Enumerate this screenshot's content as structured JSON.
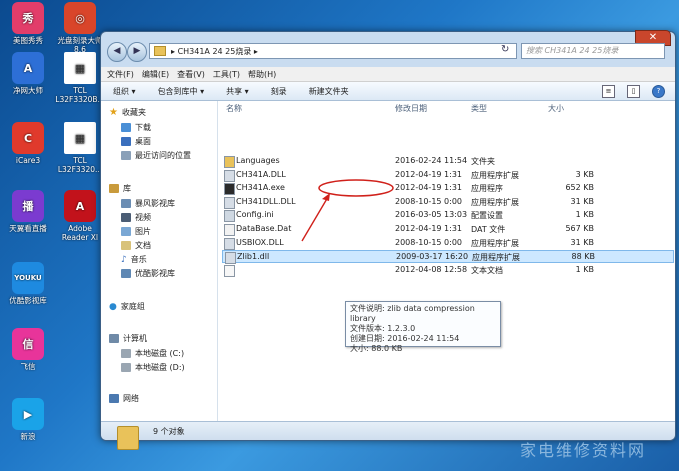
{
  "desktop": {
    "icons": [
      {
        "label": "美图秀秀",
        "color": "#e23d6a",
        "glyph": "秀"
      },
      {
        "label": "光盘刻录大师 8.6",
        "color": "#d9452a",
        "glyph": "◎"
      },
      {
        "label": "净网大师",
        "color": "#2d6fd6",
        "glyph": "A"
      },
      {
        "label": "TCL L32F3320B...",
        "color": "#ffffff",
        "glyph": "▦"
      },
      {
        "label": "iCare3",
        "color": "#e03a2c",
        "glyph": "C"
      },
      {
        "label": "TCL L32F3320...",
        "color": "#ffffff",
        "glyph": "▦"
      },
      {
        "label": "天翼看直播",
        "color": "#7b3bd0",
        "glyph": "播"
      },
      {
        "label": "Adobe Reader XI",
        "color": "#c2121b",
        "glyph": "A"
      },
      {
        "label": "优酷影视库",
        "color": "#1e8ae0",
        "glyph": "YOUKU"
      },
      {
        "label": "飞信",
        "color": "#e8349a",
        "glyph": "信"
      },
      {
        "label": "新浪",
        "color": "#1aa3e8",
        "glyph": "▶"
      }
    ]
  },
  "window": {
    "address": "CH341A 24 25烧录",
    "search_placeholder": "搜索 CH341A 24 25烧录",
    "menu": [
      "文件(F)",
      "编辑(E)",
      "查看(V)",
      "工具(T)",
      "帮助(H)"
    ],
    "toolbar": [
      "组织 ▾",
      "包含到库中 ▾",
      "共享 ▾",
      "刻录",
      "新建文件夹"
    ],
    "nav": {
      "favorites": "收藏夹",
      "favorites_items": [
        "下载",
        "桌面",
        "最近访问的位置"
      ],
      "libraries": "库",
      "library_items": [
        "暴风影视库",
        "视频",
        "图片",
        "文档",
        "音乐",
        "优酷影视库"
      ],
      "homegroup": "家庭组",
      "computer": "计算机",
      "computer_items": [
        "本地磁盘 (C:)",
        "本地磁盘 (D:)"
      ],
      "network": "网络"
    },
    "columns": {
      "name": "名称",
      "date": "修改日期",
      "type": "类型",
      "size": "大小"
    },
    "files": [
      {
        "name": "Languages",
        "date": "2016-02-24 11:54",
        "type": "文件夹",
        "size": "",
        "kind": "folder"
      },
      {
        "name": "CH341A.DLL",
        "date": "2012-04-19 1:31",
        "type": "应用程序扩展",
        "size": "3 KB",
        "kind": "dll"
      },
      {
        "name": "CH341A.exe",
        "date": "2012-04-19 1:31",
        "type": "应用程序",
        "size": "652 KB",
        "kind": "exe"
      },
      {
        "name": "CH341DLL.DLL",
        "date": "2008-10-15 0:00",
        "type": "应用程序扩展",
        "size": "31 KB",
        "kind": "dll"
      },
      {
        "name": "Config.ini",
        "date": "2016-03-05 13:03",
        "type": "配置设置",
        "size": "1 KB",
        "kind": "ini"
      },
      {
        "name": "DataBase.Dat",
        "date": "2012-04-19 1:31",
        "type": "DAT 文件",
        "size": "567 KB",
        "kind": "dat"
      },
      {
        "name": "USBIOX.DLL",
        "date": "2008-10-15 0:00",
        "type": "应用程序扩展",
        "size": "31 KB",
        "kind": "dll"
      },
      {
        "name": "Zlib1.dll",
        "date": "2009-03-17 16:20",
        "type": "应用程序扩展",
        "size": "88 KB",
        "kind": "dll"
      },
      {
        "name": "",
        "date": "2012-04-08 12:58",
        "type": "文本文档",
        "size": "1 KB",
        "kind": "txt"
      }
    ],
    "tooltip": {
      "line1": "文件说明: zlib data compression library",
      "line2": "文件版本: 1.2.3.0",
      "line3": "创建日期: 2016-02-24 11:54",
      "line4": "大小: 88.0 KB"
    },
    "status": "9 个对象"
  },
  "watermark": "家电维修资料网"
}
